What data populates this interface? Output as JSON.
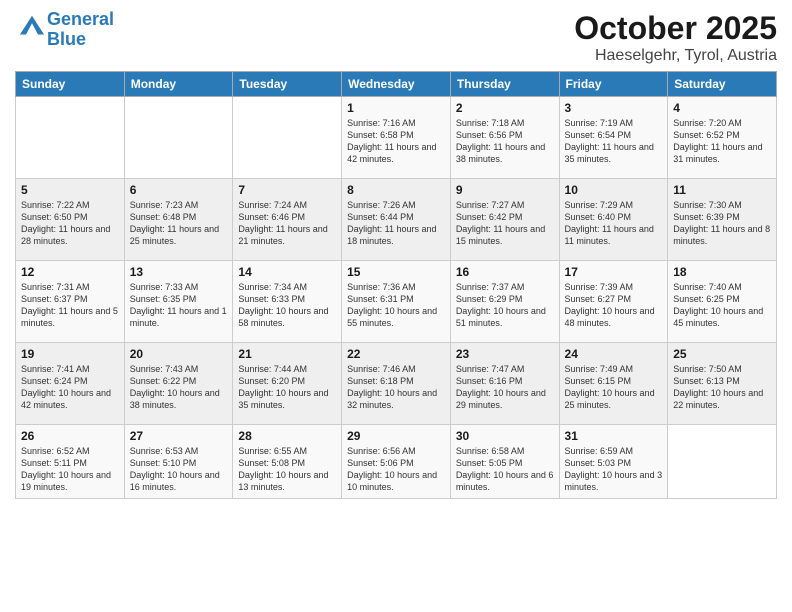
{
  "header": {
    "logo_line1": "General",
    "logo_line2": "Blue",
    "month": "October 2025",
    "location": "Haeselgehr, Tyrol, Austria"
  },
  "days_of_week": [
    "Sunday",
    "Monday",
    "Tuesday",
    "Wednesday",
    "Thursday",
    "Friday",
    "Saturday"
  ],
  "weeks": [
    [
      {
        "day": "",
        "info": ""
      },
      {
        "day": "",
        "info": ""
      },
      {
        "day": "",
        "info": ""
      },
      {
        "day": "1",
        "info": "Sunrise: 7:16 AM\nSunset: 6:58 PM\nDaylight: 11 hours and 42 minutes."
      },
      {
        "day": "2",
        "info": "Sunrise: 7:18 AM\nSunset: 6:56 PM\nDaylight: 11 hours and 38 minutes."
      },
      {
        "day": "3",
        "info": "Sunrise: 7:19 AM\nSunset: 6:54 PM\nDaylight: 11 hours and 35 minutes."
      },
      {
        "day": "4",
        "info": "Sunrise: 7:20 AM\nSunset: 6:52 PM\nDaylight: 11 hours and 31 minutes."
      }
    ],
    [
      {
        "day": "5",
        "info": "Sunrise: 7:22 AM\nSunset: 6:50 PM\nDaylight: 11 hours and 28 minutes."
      },
      {
        "day": "6",
        "info": "Sunrise: 7:23 AM\nSunset: 6:48 PM\nDaylight: 11 hours and 25 minutes."
      },
      {
        "day": "7",
        "info": "Sunrise: 7:24 AM\nSunset: 6:46 PM\nDaylight: 11 hours and 21 minutes."
      },
      {
        "day": "8",
        "info": "Sunrise: 7:26 AM\nSunset: 6:44 PM\nDaylight: 11 hours and 18 minutes."
      },
      {
        "day": "9",
        "info": "Sunrise: 7:27 AM\nSunset: 6:42 PM\nDaylight: 11 hours and 15 minutes."
      },
      {
        "day": "10",
        "info": "Sunrise: 7:29 AM\nSunset: 6:40 PM\nDaylight: 11 hours and 11 minutes."
      },
      {
        "day": "11",
        "info": "Sunrise: 7:30 AM\nSunset: 6:39 PM\nDaylight: 11 hours and 8 minutes."
      }
    ],
    [
      {
        "day": "12",
        "info": "Sunrise: 7:31 AM\nSunset: 6:37 PM\nDaylight: 11 hours and 5 minutes."
      },
      {
        "day": "13",
        "info": "Sunrise: 7:33 AM\nSunset: 6:35 PM\nDaylight: 11 hours and 1 minute."
      },
      {
        "day": "14",
        "info": "Sunrise: 7:34 AM\nSunset: 6:33 PM\nDaylight: 10 hours and 58 minutes."
      },
      {
        "day": "15",
        "info": "Sunrise: 7:36 AM\nSunset: 6:31 PM\nDaylight: 10 hours and 55 minutes."
      },
      {
        "day": "16",
        "info": "Sunrise: 7:37 AM\nSunset: 6:29 PM\nDaylight: 10 hours and 51 minutes."
      },
      {
        "day": "17",
        "info": "Sunrise: 7:39 AM\nSunset: 6:27 PM\nDaylight: 10 hours and 48 minutes."
      },
      {
        "day": "18",
        "info": "Sunrise: 7:40 AM\nSunset: 6:25 PM\nDaylight: 10 hours and 45 minutes."
      }
    ],
    [
      {
        "day": "19",
        "info": "Sunrise: 7:41 AM\nSunset: 6:24 PM\nDaylight: 10 hours and 42 minutes."
      },
      {
        "day": "20",
        "info": "Sunrise: 7:43 AM\nSunset: 6:22 PM\nDaylight: 10 hours and 38 minutes."
      },
      {
        "day": "21",
        "info": "Sunrise: 7:44 AM\nSunset: 6:20 PM\nDaylight: 10 hours and 35 minutes."
      },
      {
        "day": "22",
        "info": "Sunrise: 7:46 AM\nSunset: 6:18 PM\nDaylight: 10 hours and 32 minutes."
      },
      {
        "day": "23",
        "info": "Sunrise: 7:47 AM\nSunset: 6:16 PM\nDaylight: 10 hours and 29 minutes."
      },
      {
        "day": "24",
        "info": "Sunrise: 7:49 AM\nSunset: 6:15 PM\nDaylight: 10 hours and 25 minutes."
      },
      {
        "day": "25",
        "info": "Sunrise: 7:50 AM\nSunset: 6:13 PM\nDaylight: 10 hours and 22 minutes."
      }
    ],
    [
      {
        "day": "26",
        "info": "Sunrise: 6:52 AM\nSunset: 5:11 PM\nDaylight: 10 hours and 19 minutes."
      },
      {
        "day": "27",
        "info": "Sunrise: 6:53 AM\nSunset: 5:10 PM\nDaylight: 10 hours and 16 minutes."
      },
      {
        "day": "28",
        "info": "Sunrise: 6:55 AM\nSunset: 5:08 PM\nDaylight: 10 hours and 13 minutes."
      },
      {
        "day": "29",
        "info": "Sunrise: 6:56 AM\nSunset: 5:06 PM\nDaylight: 10 hours and 10 minutes."
      },
      {
        "day": "30",
        "info": "Sunrise: 6:58 AM\nSunset: 5:05 PM\nDaylight: 10 hours and 6 minutes."
      },
      {
        "day": "31",
        "info": "Sunrise: 6:59 AM\nSunset: 5:03 PM\nDaylight: 10 hours and 3 minutes."
      },
      {
        "day": "",
        "info": ""
      }
    ]
  ]
}
